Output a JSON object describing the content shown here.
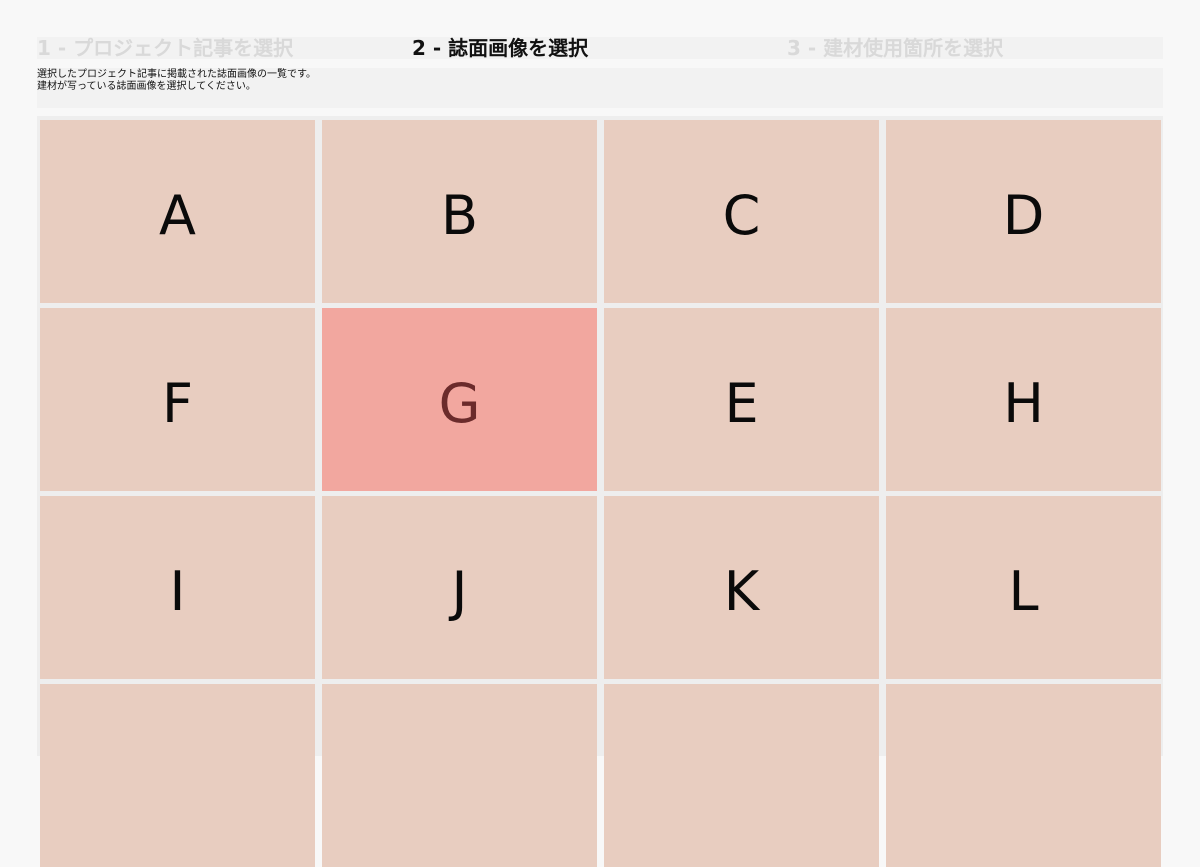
{
  "steps": [
    {
      "label": "1 - プロジェクト記事を選択",
      "state": "inactive"
    },
    {
      "label": "2 - 誌面画像を選択",
      "state": "active"
    },
    {
      "label": "3 - 建材使用箇所を選択",
      "state": "inactive"
    }
  ],
  "instructions": {
    "line1": "選択したプロジェクト記事に掲載された誌面画像の一覧です。",
    "line2": "建材が写っている誌面画像を選択してください。"
  },
  "images": [
    {
      "label": "A",
      "selected": false
    },
    {
      "label": "B",
      "selected": false
    },
    {
      "label": "C",
      "selected": false
    },
    {
      "label": "D",
      "selected": false
    },
    {
      "label": "F",
      "selected": false
    },
    {
      "label": "G",
      "selected": true
    },
    {
      "label": "E",
      "selected": false
    },
    {
      "label": "H",
      "selected": false
    },
    {
      "label": "I",
      "selected": false
    },
    {
      "label": "J",
      "selected": false
    },
    {
      "label": "K",
      "selected": false
    },
    {
      "label": "L",
      "selected": false
    },
    {
      "label": "",
      "selected": false
    },
    {
      "label": "",
      "selected": false
    },
    {
      "label": "",
      "selected": false
    },
    {
      "label": "",
      "selected": false
    }
  ],
  "colors": {
    "tile": "#e8cdc0",
    "tile_selected": "#f2a79f",
    "step_inactive": "#d9d9d9",
    "step_active": "#111111"
  }
}
